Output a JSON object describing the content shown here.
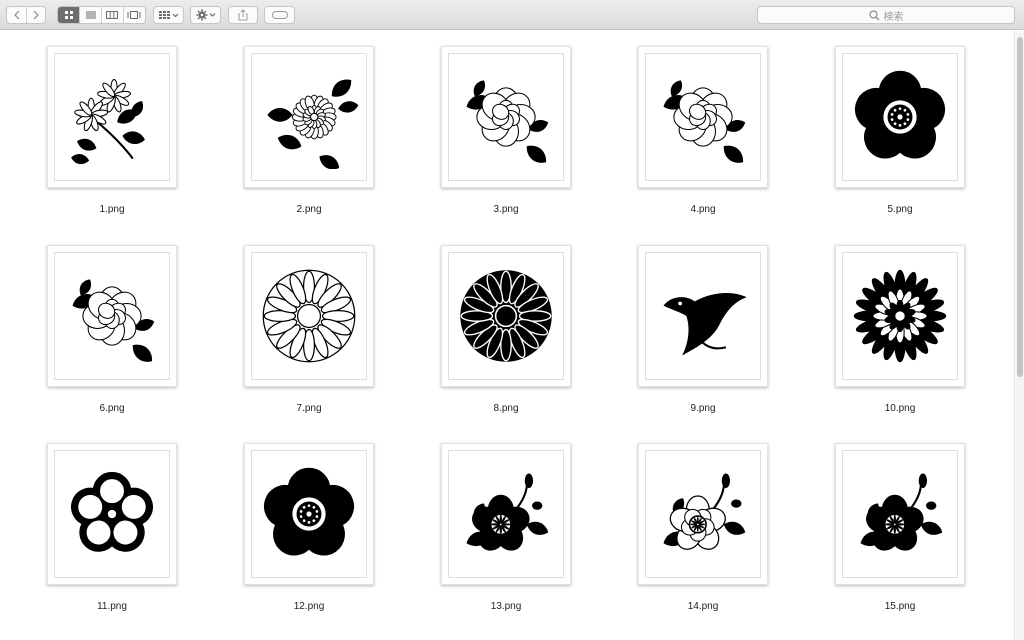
{
  "toolbar": {
    "back_icon": "chevron-left-icon",
    "forward_icon": "chevron-right-icon",
    "view_modes": [
      "icon-view",
      "list-view",
      "column-view",
      "gallery-view"
    ],
    "active_view": "icon-view",
    "search_placeholder": "検索"
  },
  "files": [
    {
      "name": "1.png",
      "icon": "chrysanthemum-sprig"
    },
    {
      "name": "2.png",
      "icon": "chrysanthemum-leaves"
    },
    {
      "name": "3.png",
      "icon": "peony-outline"
    },
    {
      "name": "4.png",
      "icon": "peony-outline"
    },
    {
      "name": "5.png",
      "icon": "plum-blossom-solid"
    },
    {
      "name": "6.png",
      "icon": "peony-outline"
    },
    {
      "name": "7.png",
      "icon": "chrysanthemum-crest-outline"
    },
    {
      "name": "8.png",
      "icon": "chrysanthemum-crest-solid"
    },
    {
      "name": "9.png",
      "icon": "bird-crest"
    },
    {
      "name": "10.png",
      "icon": "chrysanthemum-layered"
    },
    {
      "name": "11.png",
      "icon": "plum-blossom-outline"
    },
    {
      "name": "12.png",
      "icon": "plum-blossom-solid"
    },
    {
      "name": "13.png",
      "icon": "cherry-blossom-branch-solid"
    },
    {
      "name": "14.png",
      "icon": "cherry-blossom-branch-outline"
    },
    {
      "name": "15.png",
      "icon": "cherry-blossom-branch-solid"
    }
  ]
}
